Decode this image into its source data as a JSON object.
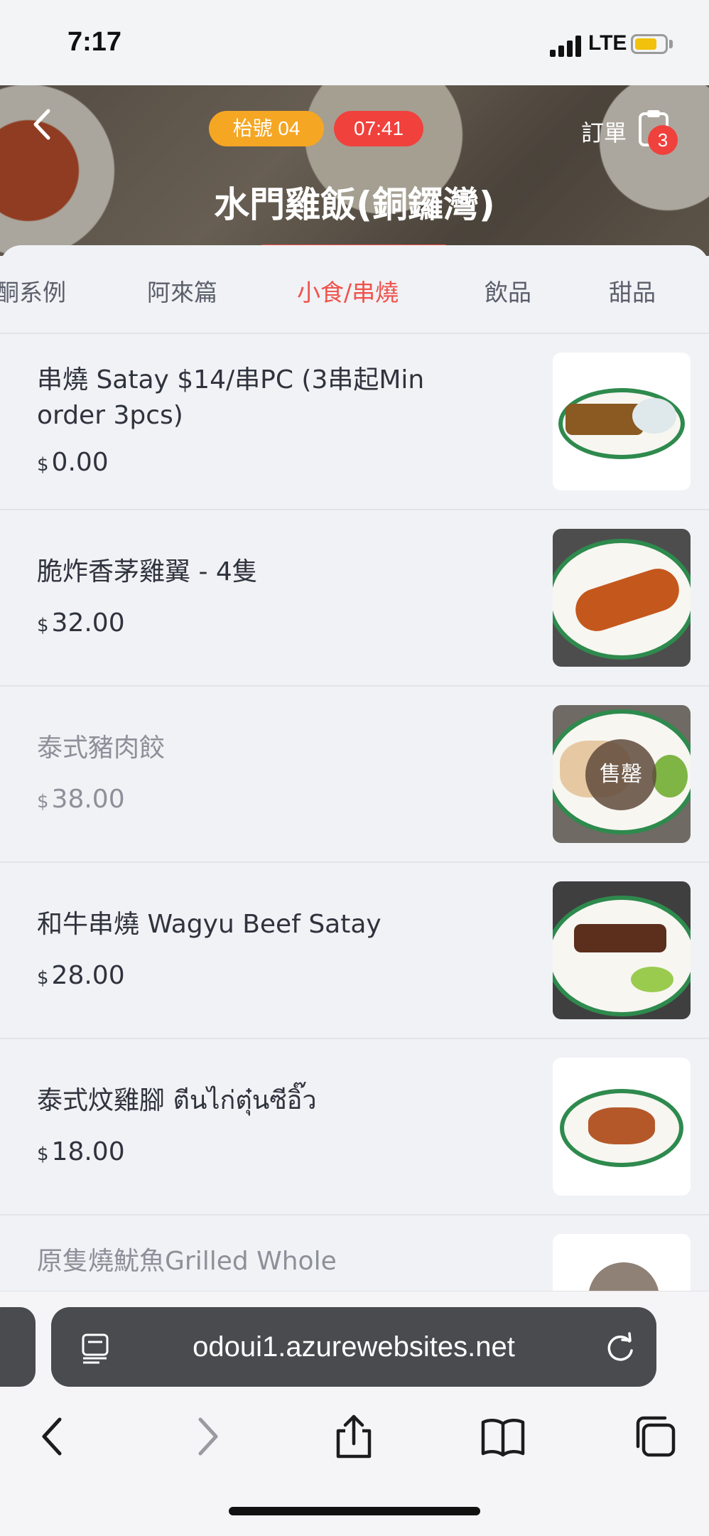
{
  "status_bar": {
    "time": "7:17",
    "network": "LTE",
    "battery_level": 0.75
  },
  "header": {
    "back_icon": "chevron-left-icon",
    "table_label": "枱號 04",
    "timer": "07:41",
    "order_label": "訂單",
    "order_count": "3",
    "store_name": "水門雞飯(銅鑼灣)"
  },
  "tabs": [
    {
      "label": "酮系例",
      "active": false
    },
    {
      "label": "阿來篇",
      "active": false
    },
    {
      "label": "小食/串燒",
      "active": true
    },
    {
      "label": "飲品",
      "active": false
    },
    {
      "label": "甜品",
      "active": false
    }
  ],
  "currency_symbol": "$",
  "menu_items": [
    {
      "name": "串燒 Satay $14/串PC (3串起Min order 3pcs)",
      "price": "0.00",
      "sold_out": false
    },
    {
      "name": "脆炸香茅雞翼 - 4隻",
      "price": "32.00",
      "sold_out": false
    },
    {
      "name": "泰式豬肉餃",
      "price": "38.00",
      "sold_out": true,
      "sold_out_label": "售罄"
    },
    {
      "name": "和牛串燒 Wagyu Beef Satay",
      "price": "28.00",
      "sold_out": false
    },
    {
      "name": "泰式炆雞腳 ตีนไก่ตุ๋นซีอิ๊ว",
      "price": "18.00",
      "sold_out": false
    },
    {
      "name": "原隻燒魷魚Grilled Whole",
      "sold_out": true
    }
  ],
  "browser": {
    "url": "odoui1.azurewebsites.net",
    "reader_icon": "reader-mode-icon",
    "reload_icon": "reload-icon",
    "toolbar": [
      "back-icon",
      "forward-icon",
      "share-icon",
      "bookmarks-icon",
      "tabs-icon"
    ]
  },
  "colors": {
    "accent": "#f0524c",
    "table_pill": "#f5a623",
    "timer_pill": "#f0413d",
    "plate_rim": "#2e8a4d"
  }
}
